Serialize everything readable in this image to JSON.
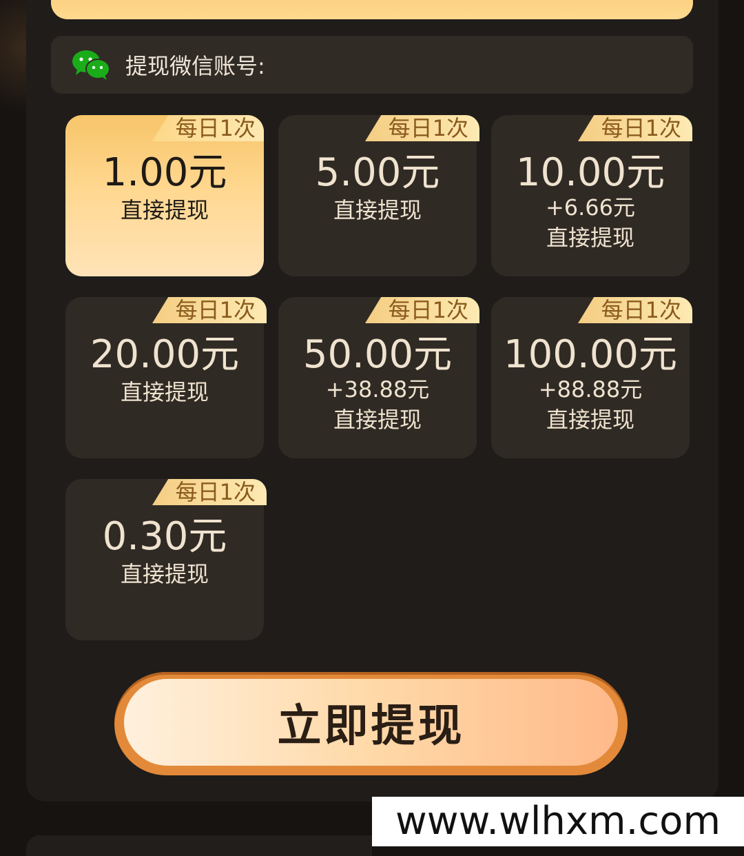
{
  "wechat": {
    "label": "提现微信账号:"
  },
  "options": [
    {
      "badge": "每日1次",
      "amount": "1.00元",
      "bonus": "",
      "action": "直接提现",
      "selected": true
    },
    {
      "badge": "每日1次",
      "amount": "5.00元",
      "bonus": "",
      "action": "直接提现",
      "selected": false
    },
    {
      "badge": "每日1次",
      "amount": "10.00元",
      "bonus": "+6.66元",
      "action": "直接提现",
      "selected": false
    },
    {
      "badge": "每日1次",
      "amount": "20.00元",
      "bonus": "",
      "action": "直接提现",
      "selected": false
    },
    {
      "badge": "每日1次",
      "amount": "50.00元",
      "bonus": "+38.88元",
      "action": "直接提现",
      "selected": false
    },
    {
      "badge": "每日1次",
      "amount": "100.00元",
      "bonus": "+88.88元",
      "action": "直接提现",
      "selected": false
    },
    {
      "badge": "每日1次",
      "amount": "0.30元",
      "bonus": "",
      "action": "直接提现",
      "selected": false
    }
  ],
  "cta": {
    "label": "立即提现"
  },
  "watermark": "www.wlhxm.com",
  "colors": {
    "accent": "#f7c56a",
    "card_bg": "#302a25",
    "panel_bg": "#1f1c1a",
    "wechat_green": "#1aad19"
  }
}
